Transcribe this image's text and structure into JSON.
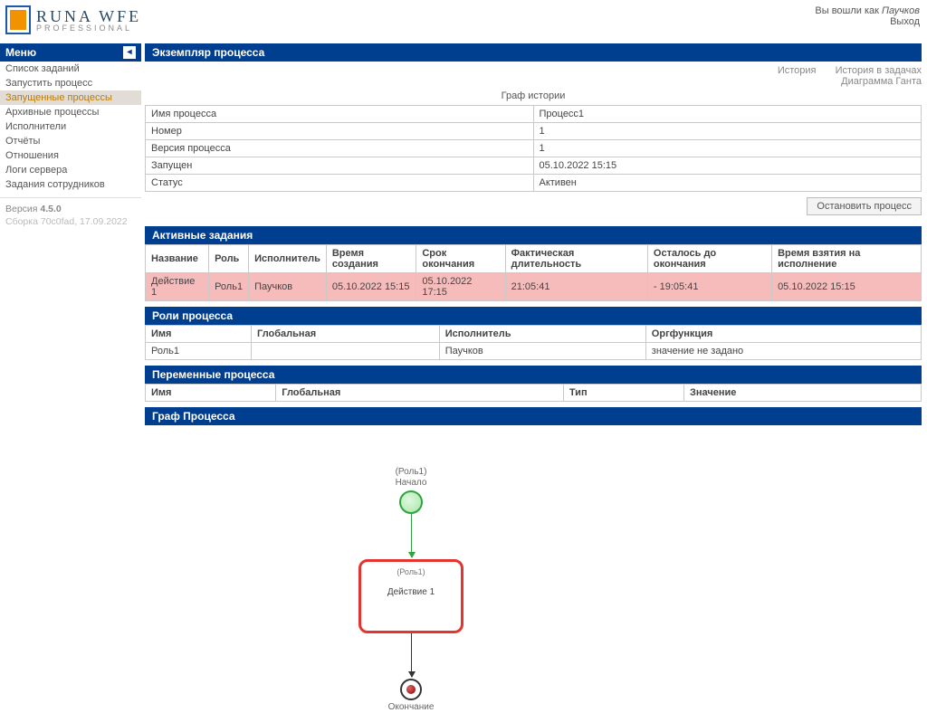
{
  "header": {
    "logo_text1": "RUNA WFE",
    "logo_text2": "PROFESSIONAL",
    "logged_in_prefix": "Вы вошли как ",
    "username": "Паучков",
    "logout": "Выход"
  },
  "sidebar": {
    "menu_title": "Меню",
    "items": [
      {
        "label": "Список заданий",
        "active": false
      },
      {
        "label": "Запустить процесс",
        "active": false
      },
      {
        "label": "Запущенные процессы",
        "active": true
      },
      {
        "label": "Архивные процессы",
        "active": false
      },
      {
        "label": "Исполнители",
        "active": false
      },
      {
        "label": "Отчёты",
        "active": false
      },
      {
        "label": "Отношения",
        "active": false
      },
      {
        "label": "Логи сервера",
        "active": false
      },
      {
        "label": "Задания сотрудников",
        "active": false
      }
    ],
    "version_label": "Версия ",
    "version": "4.5.0",
    "build": "Сборка 70c0fad, 17.09.2022"
  },
  "main": {
    "title": "Экземпляр процесса",
    "top_links": {
      "history": "История",
      "history_in_tasks": "История в задачах",
      "gantt": "Диаграмма Ганта"
    },
    "history_graph": "Граф истории",
    "info_table": [
      {
        "k": "Имя процесса",
        "v": "Процесс1"
      },
      {
        "k": "Номер",
        "v": "1"
      },
      {
        "k": "Версия процесса",
        "v": "1"
      },
      {
        "k": "Запущен",
        "v": "05.10.2022 15:15"
      },
      {
        "k": "Статус",
        "v": "Активен"
      }
    ],
    "stop_button": "Остановить процесс",
    "active_tasks": {
      "title": "Активные задания",
      "headers": [
        "Название",
        "Роль",
        "Исполнитель",
        "Время создания",
        "Срок окончания",
        "Фактическая длительность",
        "Осталось до окончания",
        "Время взятия на исполнение"
      ],
      "row": [
        "Действие 1",
        "Роль1",
        "Паучков",
        "05.10.2022 15:15",
        "05.10.2022 17:15",
        "21:05:41",
        "- 19:05:41",
        "05.10.2022 15:15"
      ]
    },
    "roles": {
      "title": "Роли процесса",
      "headers": [
        "Имя",
        "Глобальная",
        "Исполнитель",
        "Оргфункция"
      ],
      "row": [
        "Роль1",
        "",
        "Паучков",
        "значение не задано"
      ]
    },
    "vars": {
      "title": "Переменные процесса",
      "headers": [
        "Имя",
        "Глобальная",
        "Тип",
        "Значение"
      ]
    },
    "graph": {
      "title": "Граф Процесса",
      "role": "(Роль1)",
      "start": "Начало",
      "task_role": "(Роль1)",
      "task_name": "Действие 1",
      "end": "Окончание"
    }
  }
}
